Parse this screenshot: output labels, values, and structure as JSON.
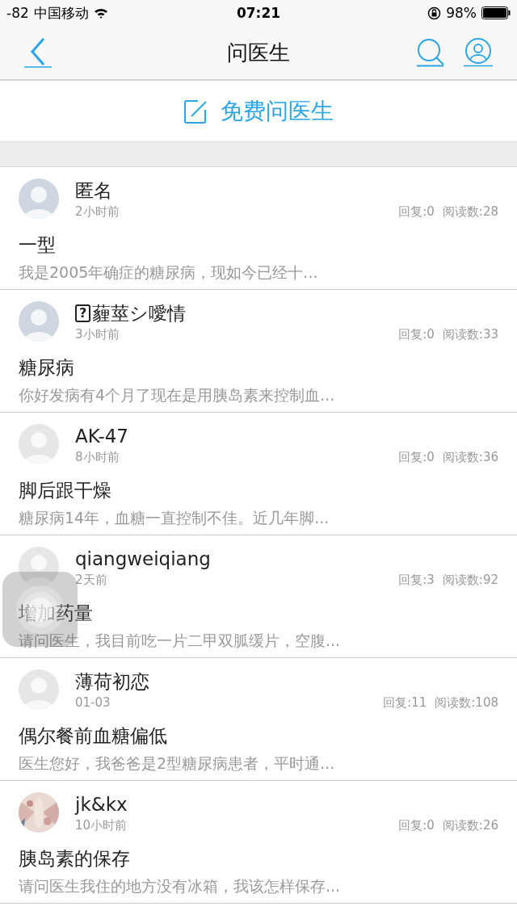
{
  "status_bar": {
    "signal": "-82",
    "carrier": "中国移动",
    "time": "07:21",
    "battery": "98%"
  },
  "nav": {
    "title": "问医生"
  },
  "ask_button": {
    "label": "免费问医生"
  },
  "posts": [
    {
      "kind": "grey-avatar",
      "name": "匿名",
      "time": "2小时前",
      "replies": "回复:0",
      "reads": "阅读数:28",
      "title": "一型",
      "summary": "我是2005年确症的糖尿病，现如今已经十..."
    },
    {
      "kind": "grey-avatar",
      "unknown_glyph": "?",
      "name": "薶莖シ噯情",
      "time": "3小时前",
      "replies": "回复:0",
      "reads": "阅读数:33",
      "title": "糖尿病",
      "summary": "你好发病有4个月了现在是用胰岛素来控制血..."
    },
    {
      "kind": "pale-avatar",
      "name": "AK-47",
      "time": "8小时前",
      "replies": "回复:0",
      "reads": "阅读数:36",
      "title": "脚后跟干燥",
      "summary": "糖尿病14年，血糖一直控制不佳。近几年脚..."
    },
    {
      "kind": "pale-avatar",
      "name": "qiangweiqiang",
      "time": "2天前",
      "replies": "回复:3",
      "reads": "阅读数:92",
      "title": "增加药量",
      "summary": "请问医生，我目前吃一片二甲双胍缓片，空腹..."
    },
    {
      "kind": "pale-avatar",
      "name": "薄荷初恋",
      "time": "01-03",
      "replies": "回复:11",
      "reads": "阅读数:108",
      "title": "偶尔餐前血糖偏低",
      "summary": "医生您好，我爸爸是2型糖尿病患者，平时通..."
    },
    {
      "kind": "photo-avatar",
      "name": "jk&kx",
      "time": "10小时前",
      "replies": "回复:0",
      "reads": "阅读数:26",
      "title": "胰岛素的保存",
      "summary": "请问医生我住的地方没有冰箱，我该怎样保存..."
    }
  ]
}
